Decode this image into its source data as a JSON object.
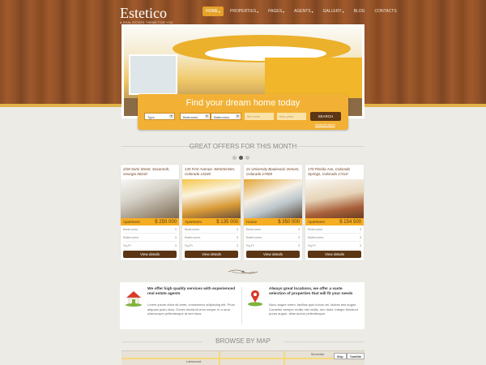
{
  "header": {
    "logo": "Estetico",
    "tagline": "A REAL ESTATE THEME FOR YOU",
    "nav": [
      {
        "label": "HOME",
        "active": true,
        "dropdown": true
      },
      {
        "label": "PROPERTIES",
        "active": false,
        "dropdown": true
      },
      {
        "label": "PAGES",
        "active": false,
        "dropdown": true
      },
      {
        "label": "AGENTS",
        "active": false,
        "dropdown": true
      },
      {
        "label": "GALLERY",
        "active": false,
        "dropdown": true
      },
      {
        "label": "BLOG",
        "active": false,
        "dropdown": false
      },
      {
        "label": "CONTACTS",
        "active": false,
        "dropdown": false
      }
    ]
  },
  "search": {
    "title": "Find your dream home today",
    "type": "Type",
    "bedrooms": "Bedrooms",
    "bathrooms": "Bathrooms",
    "min_price_placeholder": "Min price",
    "max_price_placeholder": "Max price",
    "button": "SEARCH",
    "advanced": "Advanced search"
  },
  "offers": {
    "title": "GREAT OFFERS FOR THIS MONTH",
    "dots": 3,
    "active_dot": 1,
    "row_labels": [
      "Bedrooms",
      "Bathrooms",
      "Sq.Ft"
    ],
    "view_label": "View details",
    "cards": [
      {
        "address": "2/28 Sami Street, Savannah, Georgia 00210",
        "type": "Apartment",
        "price": "$ 250 000",
        "beds": "3",
        "baths": "3",
        "sqft": "3"
      },
      {
        "address": "135 First Avenue, Westminster, Colorado 13240",
        "type": "Apartment",
        "price": "$ 135 000",
        "beds": "3",
        "baths": "3",
        "sqft": "3"
      },
      {
        "address": "21 University Boulevard, Denver, Colorado 17000",
        "type": "House",
        "price": "$ 350 000",
        "beds": "3",
        "baths": "3",
        "sqft": "3"
      },
      {
        "address": "170 Florida Ave, Colorado Springs, Colorado 17110",
        "type": "Apartment",
        "price": "$ 154 500",
        "beds": "3",
        "baths": "3",
        "sqft": "3"
      }
    ]
  },
  "info": {
    "left_heading": "We offer high quality services with experienced real estate agents",
    "left_text": "Lorem ipsum dolor sit amet, consectetur adipiscing elit. Proin aliquam justo risus. Donec tincidunt eros neque, in a urna ullamcorper pellentesque at sed risus.",
    "right_heading": "Always great locations, we offer a vaste selection of properties that will fit your needs",
    "right_text": "Nunc augue lorem, facilisis quis luctus vel, lacinia sed augue. Curabitur semper mollis nisl mollis, nec dolor. Integer tincidunt purus augue, vitae auctor pellentesque."
  },
  "map": {
    "title": "BROWSE BY MAP",
    "map_button": "Map",
    "satellite_button": "Satellite",
    "labels": [
      "Montclair",
      "Lakewood"
    ]
  }
}
